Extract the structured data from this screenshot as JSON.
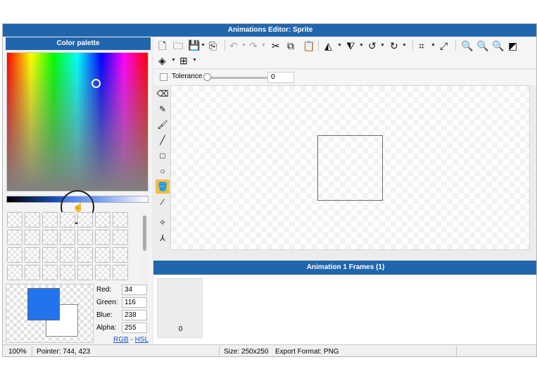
{
  "window": {
    "title": "Animations Editor: Sprite"
  },
  "palette": {
    "title": "Color palette",
    "red_label": "Red:",
    "red": "34",
    "green_label": "Green:",
    "green": "116",
    "blue_label": "Blue:",
    "blue": "238",
    "alpha_label": "Alpha:",
    "alpha": "255",
    "mode_rgb": "RGB",
    "mode_sep": " - ",
    "mode_hsl": "HSL",
    "foreground_color": "#2274ee",
    "background_color": "#ffffff"
  },
  "toolbar": {
    "icons": [
      "new-file-icon",
      "open-folder-icon",
      "save-icon",
      "export-icon",
      "undo-icon",
      "redo-icon",
      "cut-icon",
      "copy-icon",
      "paste-icon",
      "flip-horizontal-icon",
      "flip-vertical-icon",
      "rotate-left-icon",
      "rotate-right-icon",
      "crop-icon",
      "resize-icon",
      "zoom-in-icon",
      "zoom-out-icon",
      "zoom-fit-icon",
      "toggle-background-icon",
      "layers-icon",
      "grid-icon"
    ]
  },
  "options": {
    "tolerance_label": "Tolerance",
    "tolerance_value": "0",
    "tolerance_level": 0
  },
  "tools": [
    "eraser-icon",
    "pencil-icon",
    "brush-icon",
    "line-icon",
    "rectangle-icon",
    "ellipse-icon",
    "fill-bucket-icon",
    "eyedropper-icon",
    "move-point-icon",
    "node-icon"
  ],
  "frames": {
    "title": "Animation 1 Frames (1)",
    "items": [
      "0"
    ]
  },
  "status": {
    "zoom": "100%",
    "pointer": "Pointer: 744, 423",
    "size": "Size: 250x250",
    "export_format": "Export Format: PNG"
  },
  "accent_color": "#2166ac",
  "active_tool_color": "#f2bd41"
}
